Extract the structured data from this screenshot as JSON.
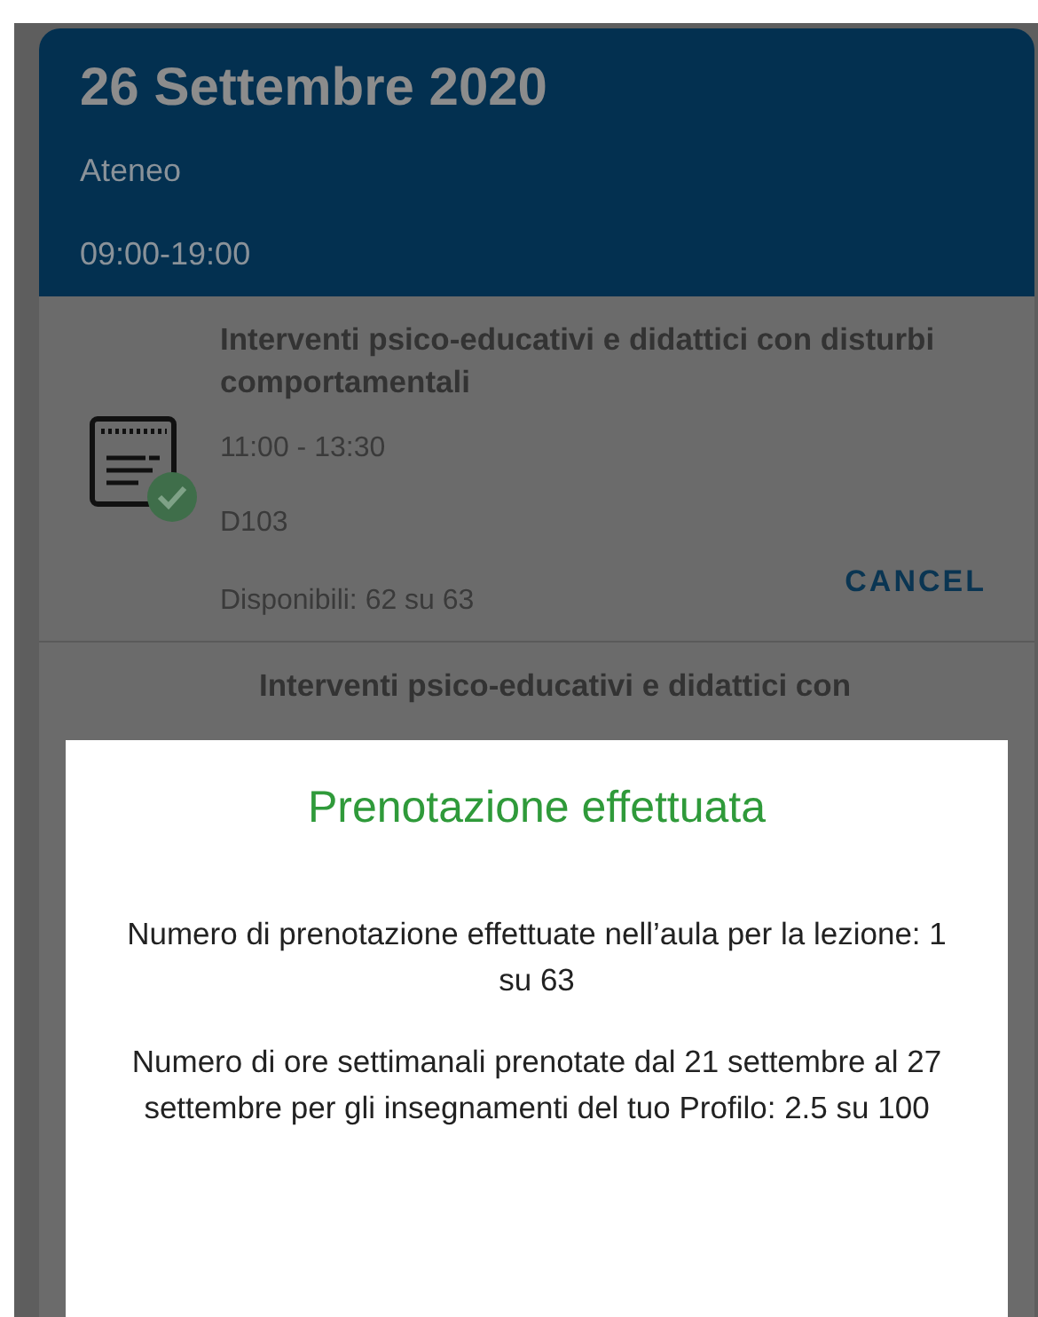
{
  "header": {
    "date": "26 Settembre 2020",
    "location": "Ateneo",
    "hours": "09:00-19:00"
  },
  "lessons": [
    {
      "title": "Interventi psico-educativi e didattici con disturbi comportamentali",
      "time": "11:00 - 13:30",
      "room": "D103",
      "availability": "Disponibili: 62 su 63",
      "booked": true,
      "action": "CANCEL"
    },
    {
      "title": "Interventi psico-educativi e didattici con"
    }
  ],
  "dialog": {
    "title": "Prenotazione effettuata",
    "paragraphs": [
      "Numero di prenotazione effettuate nell’aula per la lezione: 1 su 63",
      "Numero di ore settimanali prenotate dal 21 settembre al 27 settembre per gli insegnamenti del tuo Profilo: 2.5 su 100"
    ]
  }
}
